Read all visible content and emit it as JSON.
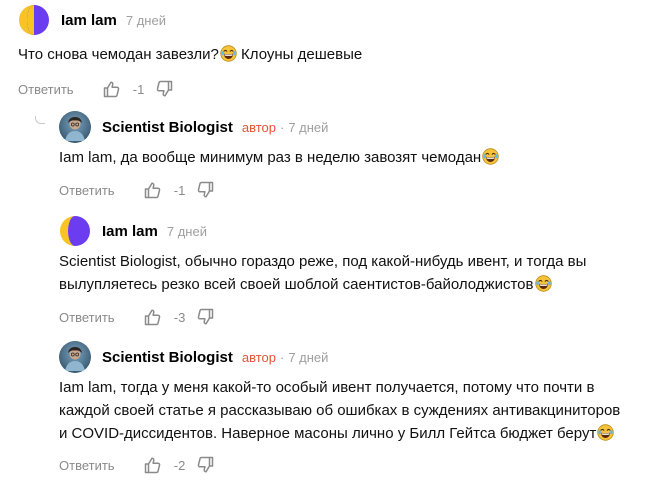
{
  "comments": [
    {
      "author": "Iam lam",
      "time": "7 дней",
      "text_lines": [
        "Что снова чемодан завезли?"
      ],
      "text_after_emoji": " Клоуны дешевые",
      "reply_label": "Ответить",
      "score": "-1",
      "avatar_style": "yellow-purple"
    },
    {
      "author": "Scientist Biologist",
      "badge": "автор",
      "separator": "·",
      "time": "7 дней",
      "text_lines": [
        "Iam lam, да вообще минимум раз в неделю завозят чемодан"
      ],
      "reply_label": "Ответить",
      "score": "-1",
      "avatar_style": "photo-blue"
    },
    {
      "author": "Iam lam",
      "time": "7 дней",
      "text_lines": [
        "Scientist Biologist, обычно гораздо реже, под какой-нибудь ивент, и тогда вы",
        "вылупляетесь резко всей своей шоблой саентистов-байолоджистов"
      ],
      "reply_label": "Ответить",
      "score": "-3",
      "avatar_style": "yellow-purple"
    },
    {
      "author": "Scientist Biologist",
      "badge": "автор",
      "separator": "·",
      "time": "7 дней",
      "text_lines": [
        "Iam lam, тогда у меня какой-то особый ивент получается, потому что почти в",
        "каждой своей статье я рассказываю об ошибках в суждениях антивакциниторов",
        "и COVID-диссидентов. Наверное масоны лично у Билл Гейтса бюджет берут"
      ],
      "reply_label": "Ответить",
      "score": "-2",
      "avatar_style": "photo-blue"
    }
  ],
  "icons": {
    "like": "thumbs-up-icon",
    "dislike": "thumbs-down-icon",
    "emoji": "laughing-emoji-icon",
    "thread": "reply-thread-icon"
  },
  "colors": {
    "badge": "#e5533a",
    "meta": "#9e9e9e",
    "actions": "#8a8a8a",
    "avatar_yellow": "#f7c325",
    "avatar_purple": "#6b3cf0"
  }
}
